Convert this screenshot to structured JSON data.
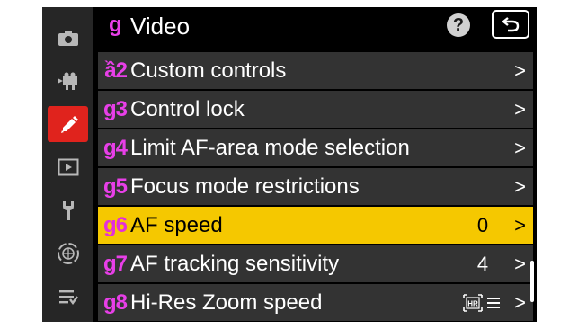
{
  "header": {
    "code": "g",
    "title": "Video",
    "help": "?"
  },
  "tabs": [
    {
      "icon": "camera-icon"
    },
    {
      "icon": "movie-camera-icon"
    },
    {
      "icon": "pencil-icon",
      "active": true
    },
    {
      "icon": "playback-icon"
    },
    {
      "icon": "wrench-icon"
    },
    {
      "icon": "network-icon"
    },
    {
      "icon": "my-menu-icon"
    }
  ],
  "menu": {
    "items": [
      {
        "code": "ầ2",
        "label": "Custom controls",
        "value": "",
        "chevron": ">"
      },
      {
        "code": "g3",
        "label": "Control lock",
        "value": "",
        "chevron": ">"
      },
      {
        "code": "g4",
        "label": "Limit AF-area mode selection",
        "value": "",
        "chevron": ">"
      },
      {
        "code": "g5",
        "label": "Focus mode restrictions",
        "value": "",
        "chevron": ">"
      },
      {
        "code": "g6",
        "label": "AF speed",
        "value": "0",
        "chevron": ">",
        "selected": true
      },
      {
        "code": "g7",
        "label": "AF tracking sensitivity",
        "value": "4",
        "chevron": ">"
      },
      {
        "code": "g8",
        "label": "Hi-Res Zoom speed",
        "value": "",
        "value_icons": [
          "hires-zoom-icon",
          "lines-icon"
        ],
        "value_icon_text": "HR",
        "chevron": ">"
      }
    ]
  },
  "colors": {
    "accent_magenta": "#e83fe8",
    "selected_bg": "#f5c800",
    "active_tab": "#e0231d"
  }
}
